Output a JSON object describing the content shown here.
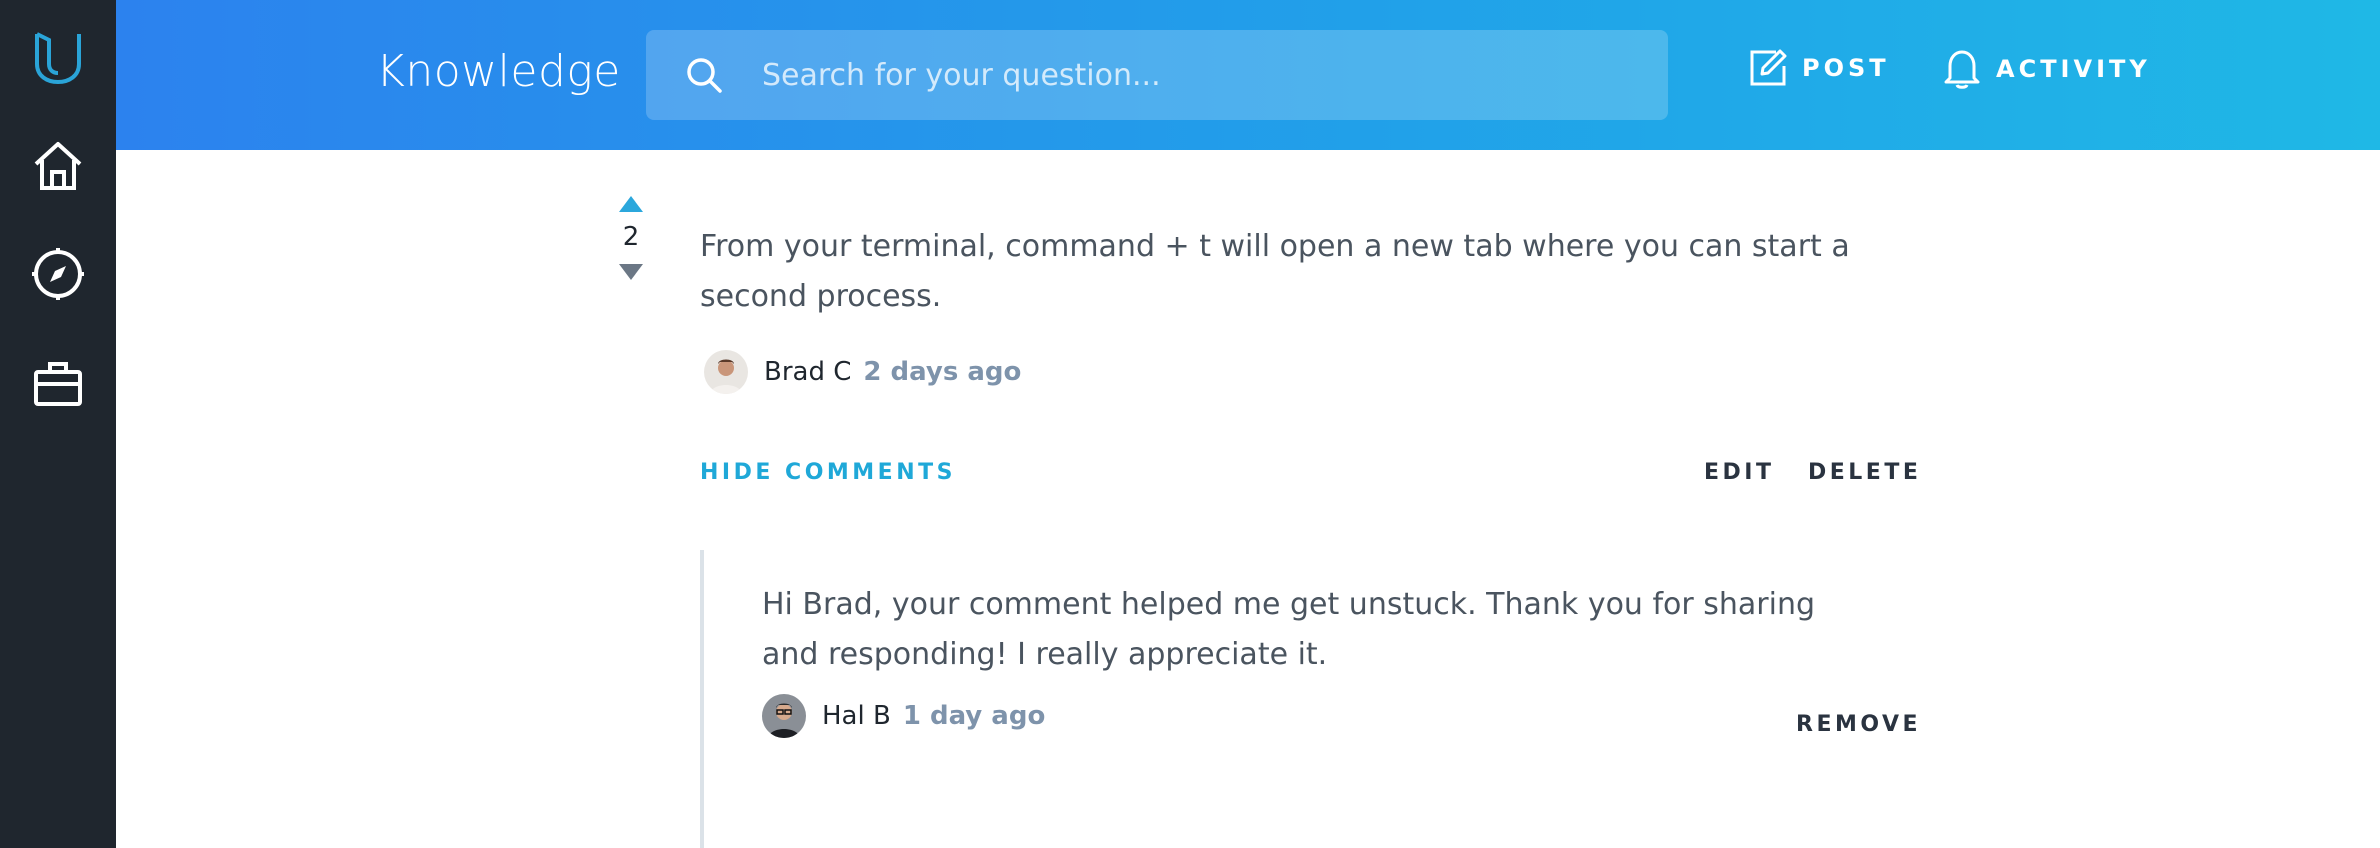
{
  "sidebar": {
    "items": [
      {
        "icon": "udacity-logo-icon"
      },
      {
        "icon": "home-icon"
      },
      {
        "icon": "compass-icon"
      },
      {
        "icon": "briefcase-icon"
      }
    ]
  },
  "header": {
    "brand": "Knowledge",
    "search_placeholder": "Search for your question...",
    "post_label": "POST",
    "activity_label": "ACTIVITY"
  },
  "answer": {
    "votes": "2",
    "text": "From your terminal, command + t will open a new tab where you can start a second process.",
    "author": "Brad C",
    "time": "2 days ago",
    "hide_comments_label": "HIDE COMMENTS",
    "edit_label": "EDIT",
    "delete_label": "DELETE"
  },
  "comment": {
    "text": "Hi Brad, your comment helped me get unstuck. Thank you for sharing and responding! I really appreciate it.",
    "author": "Hal B",
    "time": "1 day ago",
    "remove_label": "REMOVE"
  },
  "colors": {
    "sidebar_bg": "#1f262e",
    "header_gradient_start": "#2c82ee",
    "header_gradient_end": "#1fb8e6",
    "accent": "#1fa8d8",
    "timestamp": "#7e93ab"
  }
}
